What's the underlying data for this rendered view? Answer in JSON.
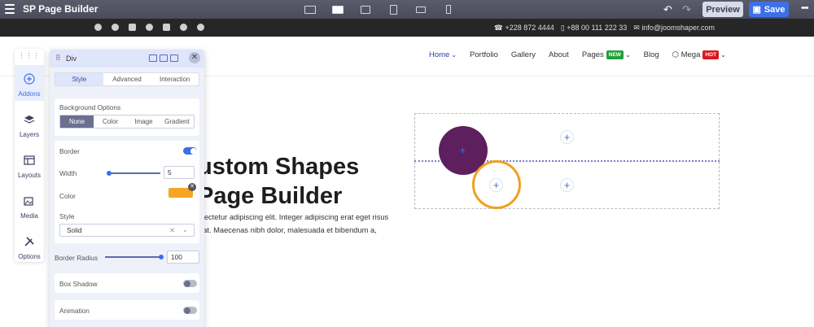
{
  "topbar": {
    "brand": "SP Page Builder",
    "undo_icon": "undo-icon",
    "redo_icon": "redo-icon",
    "preview_label": "Preview",
    "save_label": "Save",
    "more_icon": "more-dots-icon"
  },
  "infobar": {
    "phone1": "+228 872 4444",
    "phone2": "+88 00 111 222 33",
    "email": "info@joomshaper.com"
  },
  "nav": {
    "home": "Home",
    "portfolio": "Portfolio",
    "gallery": "Gallery",
    "about": "About",
    "pages": "Pages",
    "pages_badge": "NEW",
    "blog": "Blog",
    "mega": "Mega",
    "mega_badge": "HOT"
  },
  "hero": {
    "title_line1": "ustom Shapes",
    "title_line2": "Page Builder",
    "text_line1": "nsectetur adipiscing elit. Integer adipiscing erat eget risus",
    "text_line2": "erat. Maecenas nibh dolor, malesuada et bibendum a,"
  },
  "sidebar": {
    "items": [
      {
        "label": "Addons"
      },
      {
        "label": "Layers"
      },
      {
        "label": "Layouts"
      },
      {
        "label": "Media"
      },
      {
        "label": "Options"
      }
    ]
  },
  "panel": {
    "title": "Div",
    "tabs": [
      "Style",
      "Advanced",
      "Interaction"
    ],
    "bg_label": "Background Options",
    "bg_options": [
      "None",
      "Color",
      "Image",
      "Gradient"
    ],
    "border_label": "Border",
    "border_on": true,
    "width_label": "Width",
    "width_value": "5",
    "color_label": "Color",
    "color_value": "#f5a623",
    "style_label": "Style",
    "style_value": "Solid",
    "radius_label": "Border Radius",
    "radius_value": "100",
    "shadow_label": "Box Shadow",
    "animation_label": "Animation"
  },
  "colors": {
    "accent": "#3d6fe8",
    "purple_shape": "#5d1f5d",
    "orange_ring": "#f0a020"
  }
}
